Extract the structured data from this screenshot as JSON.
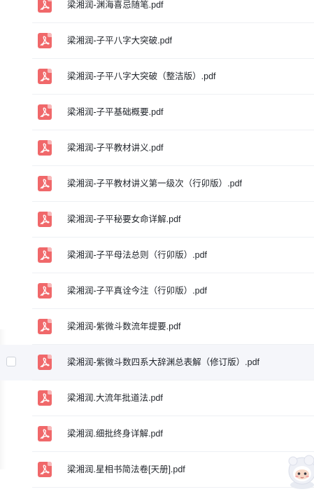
{
  "files": [
    {
      "name": "梁湘润-渊海喜忌随笔.pdf",
      "icon": "pdf-icon"
    },
    {
      "name": "梁湘润-子平八字大突破.pdf",
      "icon": "pdf-icon"
    },
    {
      "name": "梁湘润-子平八字大突破（整洁版）.pdf",
      "icon": "pdf-icon"
    },
    {
      "name": "梁湘润-子平基础概要.pdf",
      "icon": "pdf-icon"
    },
    {
      "name": "梁湘润-子平教材讲义.pdf",
      "icon": "pdf-icon"
    },
    {
      "name": "梁湘润-子平教材讲义第一级次（行卯版）.pdf",
      "icon": "pdf-icon"
    },
    {
      "name": "梁湘润-子平秘要女命详解.pdf",
      "icon": "pdf-icon"
    },
    {
      "name": "梁湘润-子平母法总则（行卯版）.pdf",
      "icon": "pdf-icon"
    },
    {
      "name": "梁湘润-子平真诠今注（行卯版）.pdf",
      "icon": "pdf-icon"
    },
    {
      "name": "梁湘润-紫微斗数流年提要.pdf",
      "icon": "pdf-icon"
    },
    {
      "name": "梁湘润-紫微斗数四系大辞渊总表解（修订版）.pdf",
      "icon": "pdf-icon"
    },
    {
      "name": "梁湘润.大流年批道法.pdf",
      "icon": "pdf-icon"
    },
    {
      "name": "梁湘润.细批终身详解.pdf",
      "icon": "pdf-icon"
    },
    {
      "name": "梁湘润.星相书简法卷[天册].pdf",
      "icon": "pdf-icon"
    }
  ],
  "hovered_row_index": 10,
  "colors": {
    "pdf_icon": "#f0686a",
    "text": "#1f2329",
    "divider": "#eef0f4",
    "hover_bg": "#f5f6fa"
  },
  "assistant": {
    "icon": "assistant-mascot-icon"
  }
}
